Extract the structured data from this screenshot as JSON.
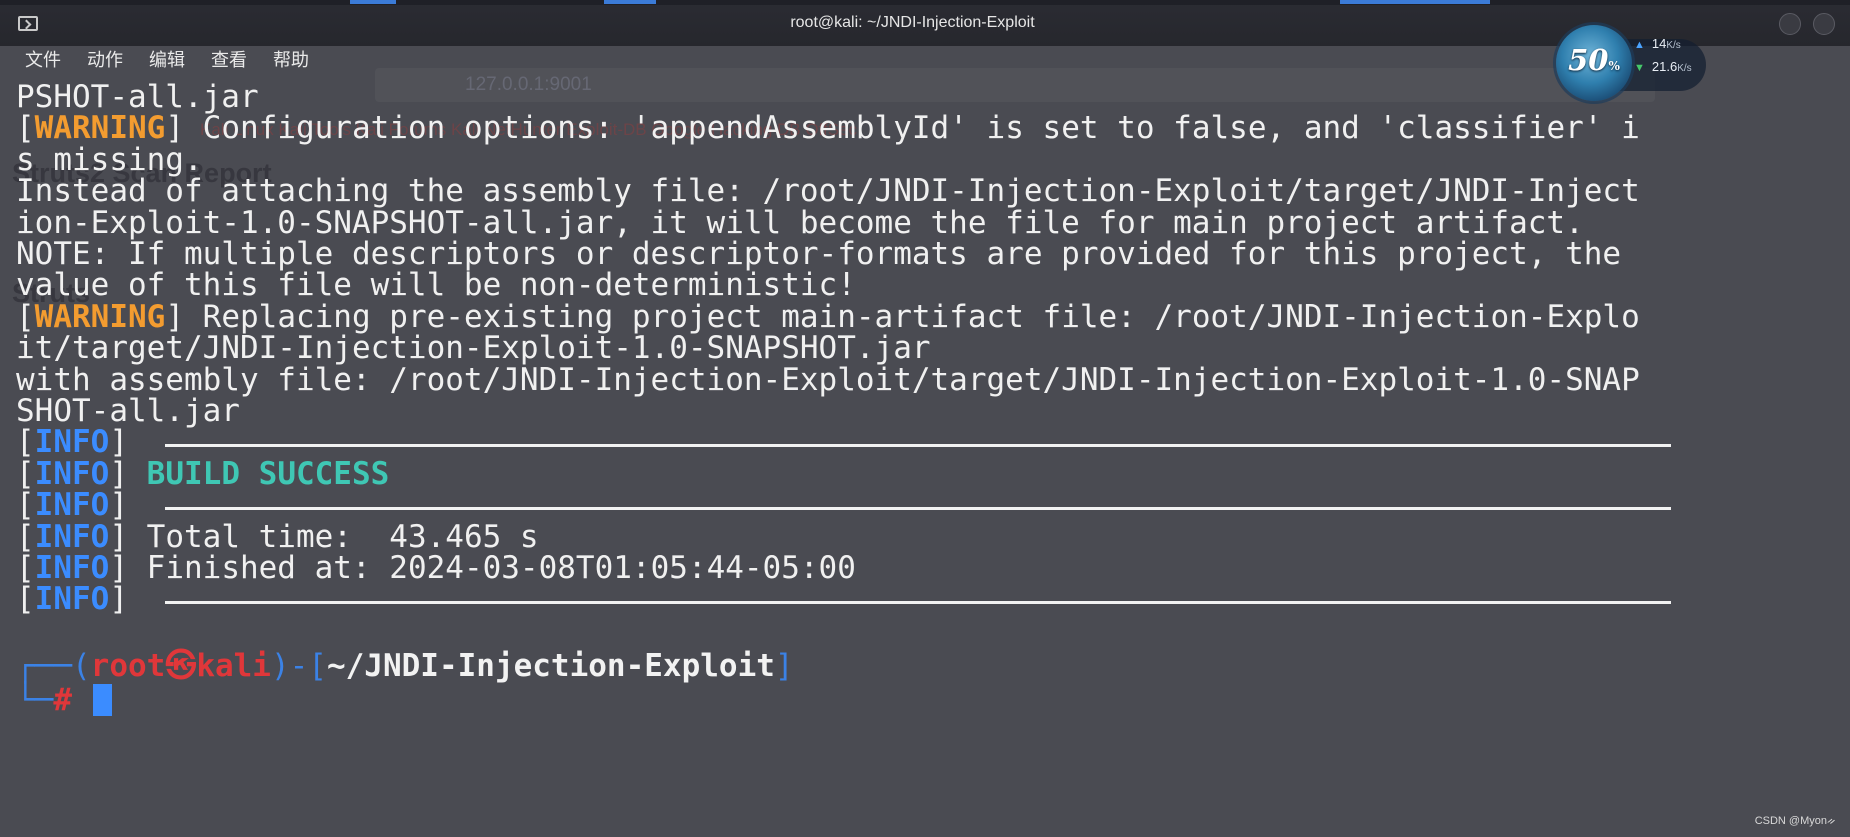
{
  "window": {
    "title": "root@kali: ~/JNDI-Injection-Exploit"
  },
  "menu": [
    "文件",
    "动作",
    "编辑",
    "查看",
    "帮助"
  ],
  "network": {
    "percent": "50",
    "percent_sign": "%",
    "upload": "14",
    "upload_unit": "K/s",
    "download": "21.6",
    "download_unit": "K/s"
  },
  "background": {
    "url": "127.0.0.1:9001",
    "page_title": "Struts2 Scan Report",
    "section": "Struts",
    "bookmarks": "Kali Linux   Kali Tools   Kali Forums   Kali NetHunter   Exploit-DB   Google Hacking DB   OffSec"
  },
  "terminal": {
    "lines": [
      {
        "text": "PSHOT-all.jar"
      },
      {
        "tag": "WARNING",
        "text": " Configuration options: 'appendAssemblyId' is set to false, and 'classifier' i"
      },
      {
        "text": "s missing."
      },
      {
        "text": "Instead of attaching the assembly file: /root/JNDI-Injection-Exploit/target/JNDI-Inject"
      },
      {
        "text": "ion-Exploit-1.0-SNAPSHOT-all.jar, it will become the file for main project artifact."
      },
      {
        "text": "NOTE: If multiple descriptors or descriptor-formats are provided for this project, the"
      },
      {
        "text": "value of this file will be non-deterministic!"
      },
      {
        "tag": "WARNING",
        "text": " Replacing pre-existing project main-artifact file: /root/JNDI-Injection-Explo"
      },
      {
        "text": "it/target/JNDI-Injection-Exploit-1.0-SNAPSHOT.jar"
      },
      {
        "text": "with assembly file: /root/JNDI-Injection-Exploit/target/JNDI-Injection-Exploit-1.0-SNAP"
      },
      {
        "text": "SHOT-all.jar"
      },
      {
        "tag": "INFO",
        "rule": true
      },
      {
        "tag": "INFO",
        "success": "BUILD SUCCESS"
      },
      {
        "tag": "INFO",
        "rule": true
      },
      {
        "tag": "INFO",
        "text": " Total time:  43.465 s"
      },
      {
        "tag": "INFO",
        "text": " Finished at: 2024-03-08T01:05:44-05:00"
      },
      {
        "tag": "INFO",
        "rule": true
      }
    ],
    "prompt": {
      "user": "root",
      "at": "㉿",
      "host": "kali",
      "path": "~/JNDI-Injection-Exploit",
      "symbol": "#"
    }
  },
  "watermark": "CSDN @Myon⁠ᨀ"
}
